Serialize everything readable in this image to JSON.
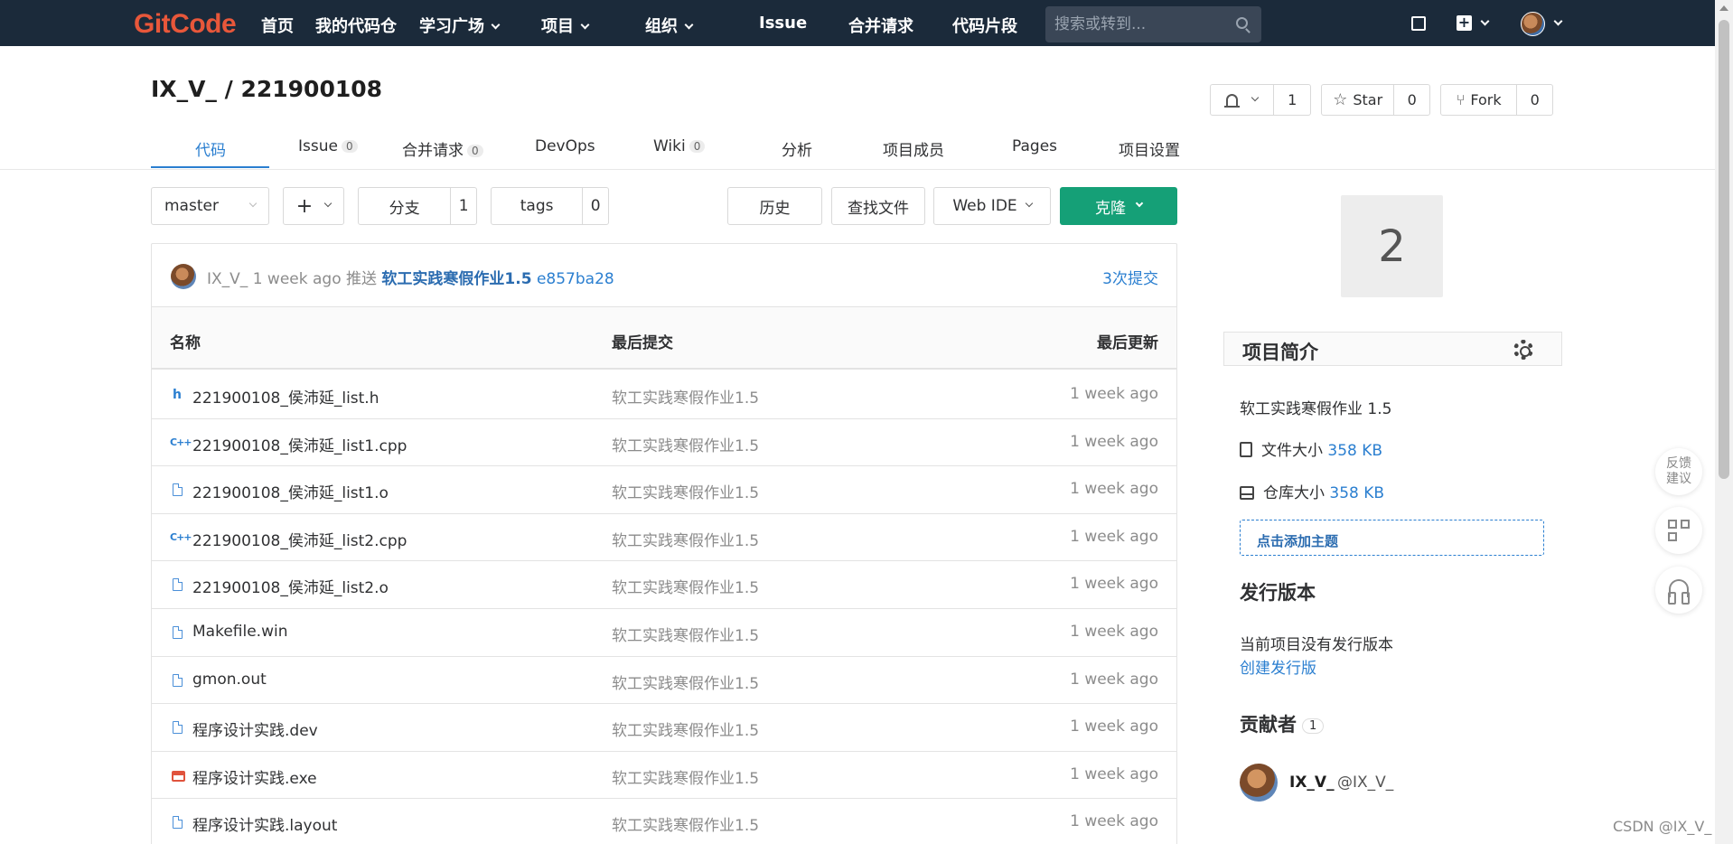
{
  "topbar": {
    "logo": {
      "g": "G",
      "rest": "itCode"
    },
    "nav": [
      {
        "label": "首页"
      },
      {
        "label": "我的代码仓"
      },
      {
        "label": "学习广场"
      },
      {
        "label": "项目"
      },
      {
        "label": "组织"
      },
      {
        "label": "Issue"
      },
      {
        "label": "合并请求"
      },
      {
        "label": "代码片段"
      }
    ],
    "search_placeholder": "搜索或转到...",
    "accent": "#1b2a3a"
  },
  "project": {
    "title": "IX_V_ / 221900108",
    "watch_count": "1",
    "star_label": "Star",
    "star_count": "0",
    "fork_label": "Fork",
    "fork_count": "0"
  },
  "tabs": [
    {
      "label": "代码",
      "badge": ""
    },
    {
      "label": "Issue",
      "badge": "0"
    },
    {
      "label": "合并请求",
      "badge": "0"
    },
    {
      "label": "DevOps",
      "badge": ""
    },
    {
      "label": "Wiki",
      "badge": "0"
    },
    {
      "label": "分析",
      "badge": ""
    },
    {
      "label": "项目成员",
      "badge": ""
    },
    {
      "label": "Pages",
      "badge": ""
    },
    {
      "label": "项目设置",
      "badge": ""
    }
  ],
  "toolbar": {
    "branch": "master",
    "add": "+",
    "branches_label": "分支",
    "branches_count": "1",
    "tags_label": "tags",
    "tags_count": "0",
    "history": "历史",
    "find_file": "查找文件",
    "web_ide": "Web IDE",
    "clone": "克隆",
    "clone_color": "#15a077"
  },
  "last_commit": {
    "author": "IX_V_",
    "time": "1 week ago",
    "action": "推送",
    "message": "软工实践寒假作业1.5",
    "hash": "e857ba28",
    "count": "3次提交"
  },
  "file_table": {
    "headers": {
      "name": "名称",
      "commit": "最后提交",
      "updated": "最后更新"
    },
    "rows": [
      {
        "icon": "h-file-icon",
        "name": "221900108_侯沛延_list.h",
        "commit": "软工实践寒假作业1.5",
        "time": "1 week ago"
      },
      {
        "icon": "cpp-file-icon",
        "name": "221900108_侯沛延_list1.cpp",
        "commit": "软工实践寒假作业1.5",
        "time": "1 week ago"
      },
      {
        "icon": "file-icon",
        "name": "221900108_侯沛延_list1.o",
        "commit": "软工实践寒假作业1.5",
        "time": "1 week ago"
      },
      {
        "icon": "cpp-file-icon",
        "name": "221900108_侯沛延_list2.cpp",
        "commit": "软工实践寒假作业1.5",
        "time": "1 week ago"
      },
      {
        "icon": "file-icon",
        "name": "221900108_侯沛延_list2.o",
        "commit": "软工实践寒假作业1.5",
        "time": "1 week ago"
      },
      {
        "icon": "file-icon",
        "name": "Makefile.win",
        "commit": "软工实践寒假作业1.5",
        "time": "1 week ago"
      },
      {
        "icon": "file-icon",
        "name": "gmon.out",
        "commit": "软工实践寒假作业1.5",
        "time": "1 week ago"
      },
      {
        "icon": "file-icon",
        "name": "程序设计实践.dev",
        "commit": "软工实践寒假作业1.5",
        "time": "1 week ago"
      },
      {
        "icon": "exe-file-icon",
        "name": "程序设计实践.exe",
        "commit": "软工实践寒假作业1.5",
        "time": "1 week ago"
      },
      {
        "icon": "file-icon",
        "name": "程序设计实践.layout",
        "commit": "软工实践寒假作业1.5",
        "time": "1 week ago"
      }
    ]
  },
  "sidebar": {
    "avatar_letter": "2",
    "intro_title": "项目简介",
    "description": "软工实践寒假作业 1.5",
    "file_size_label": "文件大小",
    "file_size": "358 KB",
    "repo_size_label": "仓库大小",
    "repo_size": "358 KB",
    "add_topic": "点击添加主题",
    "releases_title": "发行版本",
    "no_release": "当前项目没有发行版本",
    "create_release": "创建发行版",
    "contributors_title": "贡献者",
    "contributors_count": "1",
    "contributor_name": "IX_V_",
    "contributor_handle": "@IX_V_"
  },
  "float": {
    "feedback_line1": "反馈",
    "feedback_line2": "建议"
  },
  "watermark": "CSDN @IX_V_"
}
